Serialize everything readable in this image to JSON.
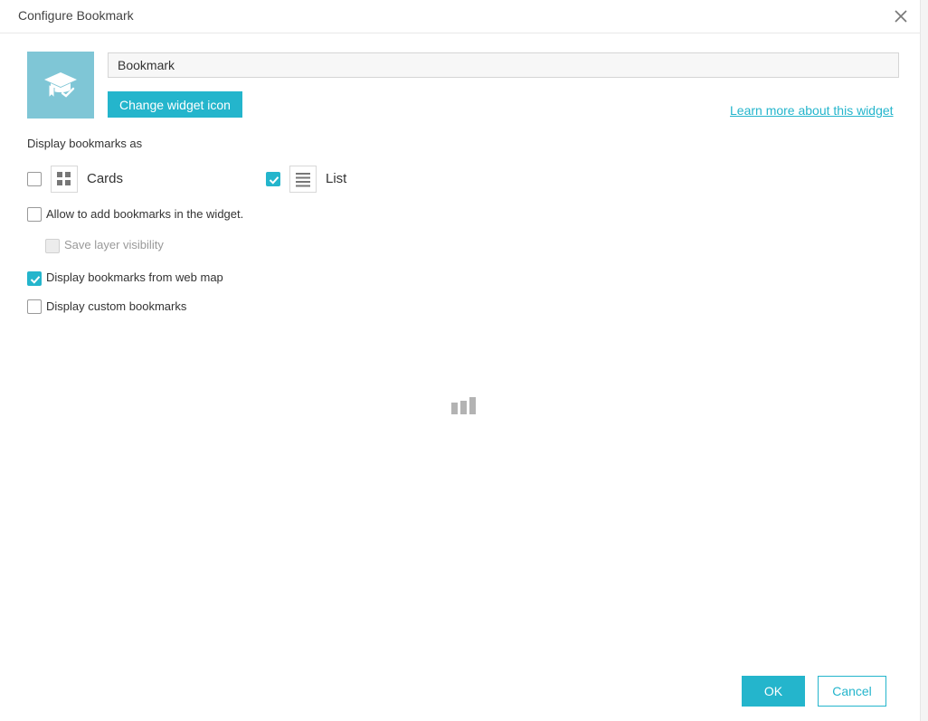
{
  "dialog": {
    "title": "Configure Bookmark",
    "close_icon": "close-icon"
  },
  "widget": {
    "icon": "graduation-cap-book-icon",
    "name_value": "Bookmark",
    "change_icon_label": "Change widget icon",
    "learn_more_label": "Learn more about this widget"
  },
  "display": {
    "label": "Display bookmarks as",
    "cards": {
      "label": "Cards",
      "checked": false,
      "icon": "grid-icon"
    },
    "list": {
      "label": "List",
      "checked": true,
      "icon": "list-icon"
    }
  },
  "options": {
    "allow_add": {
      "label": "Allow to add bookmarks in the widget.",
      "checked": false
    },
    "save_layer_visibility": {
      "label": "Save layer visibility",
      "checked": false,
      "disabled": true
    },
    "from_web_map": {
      "label": "Display bookmarks from web map",
      "checked": true
    },
    "custom": {
      "label": "Display custom bookmarks",
      "checked": false
    }
  },
  "loader_icon": "loading-bars-icon",
  "footer": {
    "ok_label": "OK",
    "cancel_label": "Cancel"
  },
  "colors": {
    "accent": "#24b5cc",
    "icon_bg": "#7fc6d6"
  }
}
